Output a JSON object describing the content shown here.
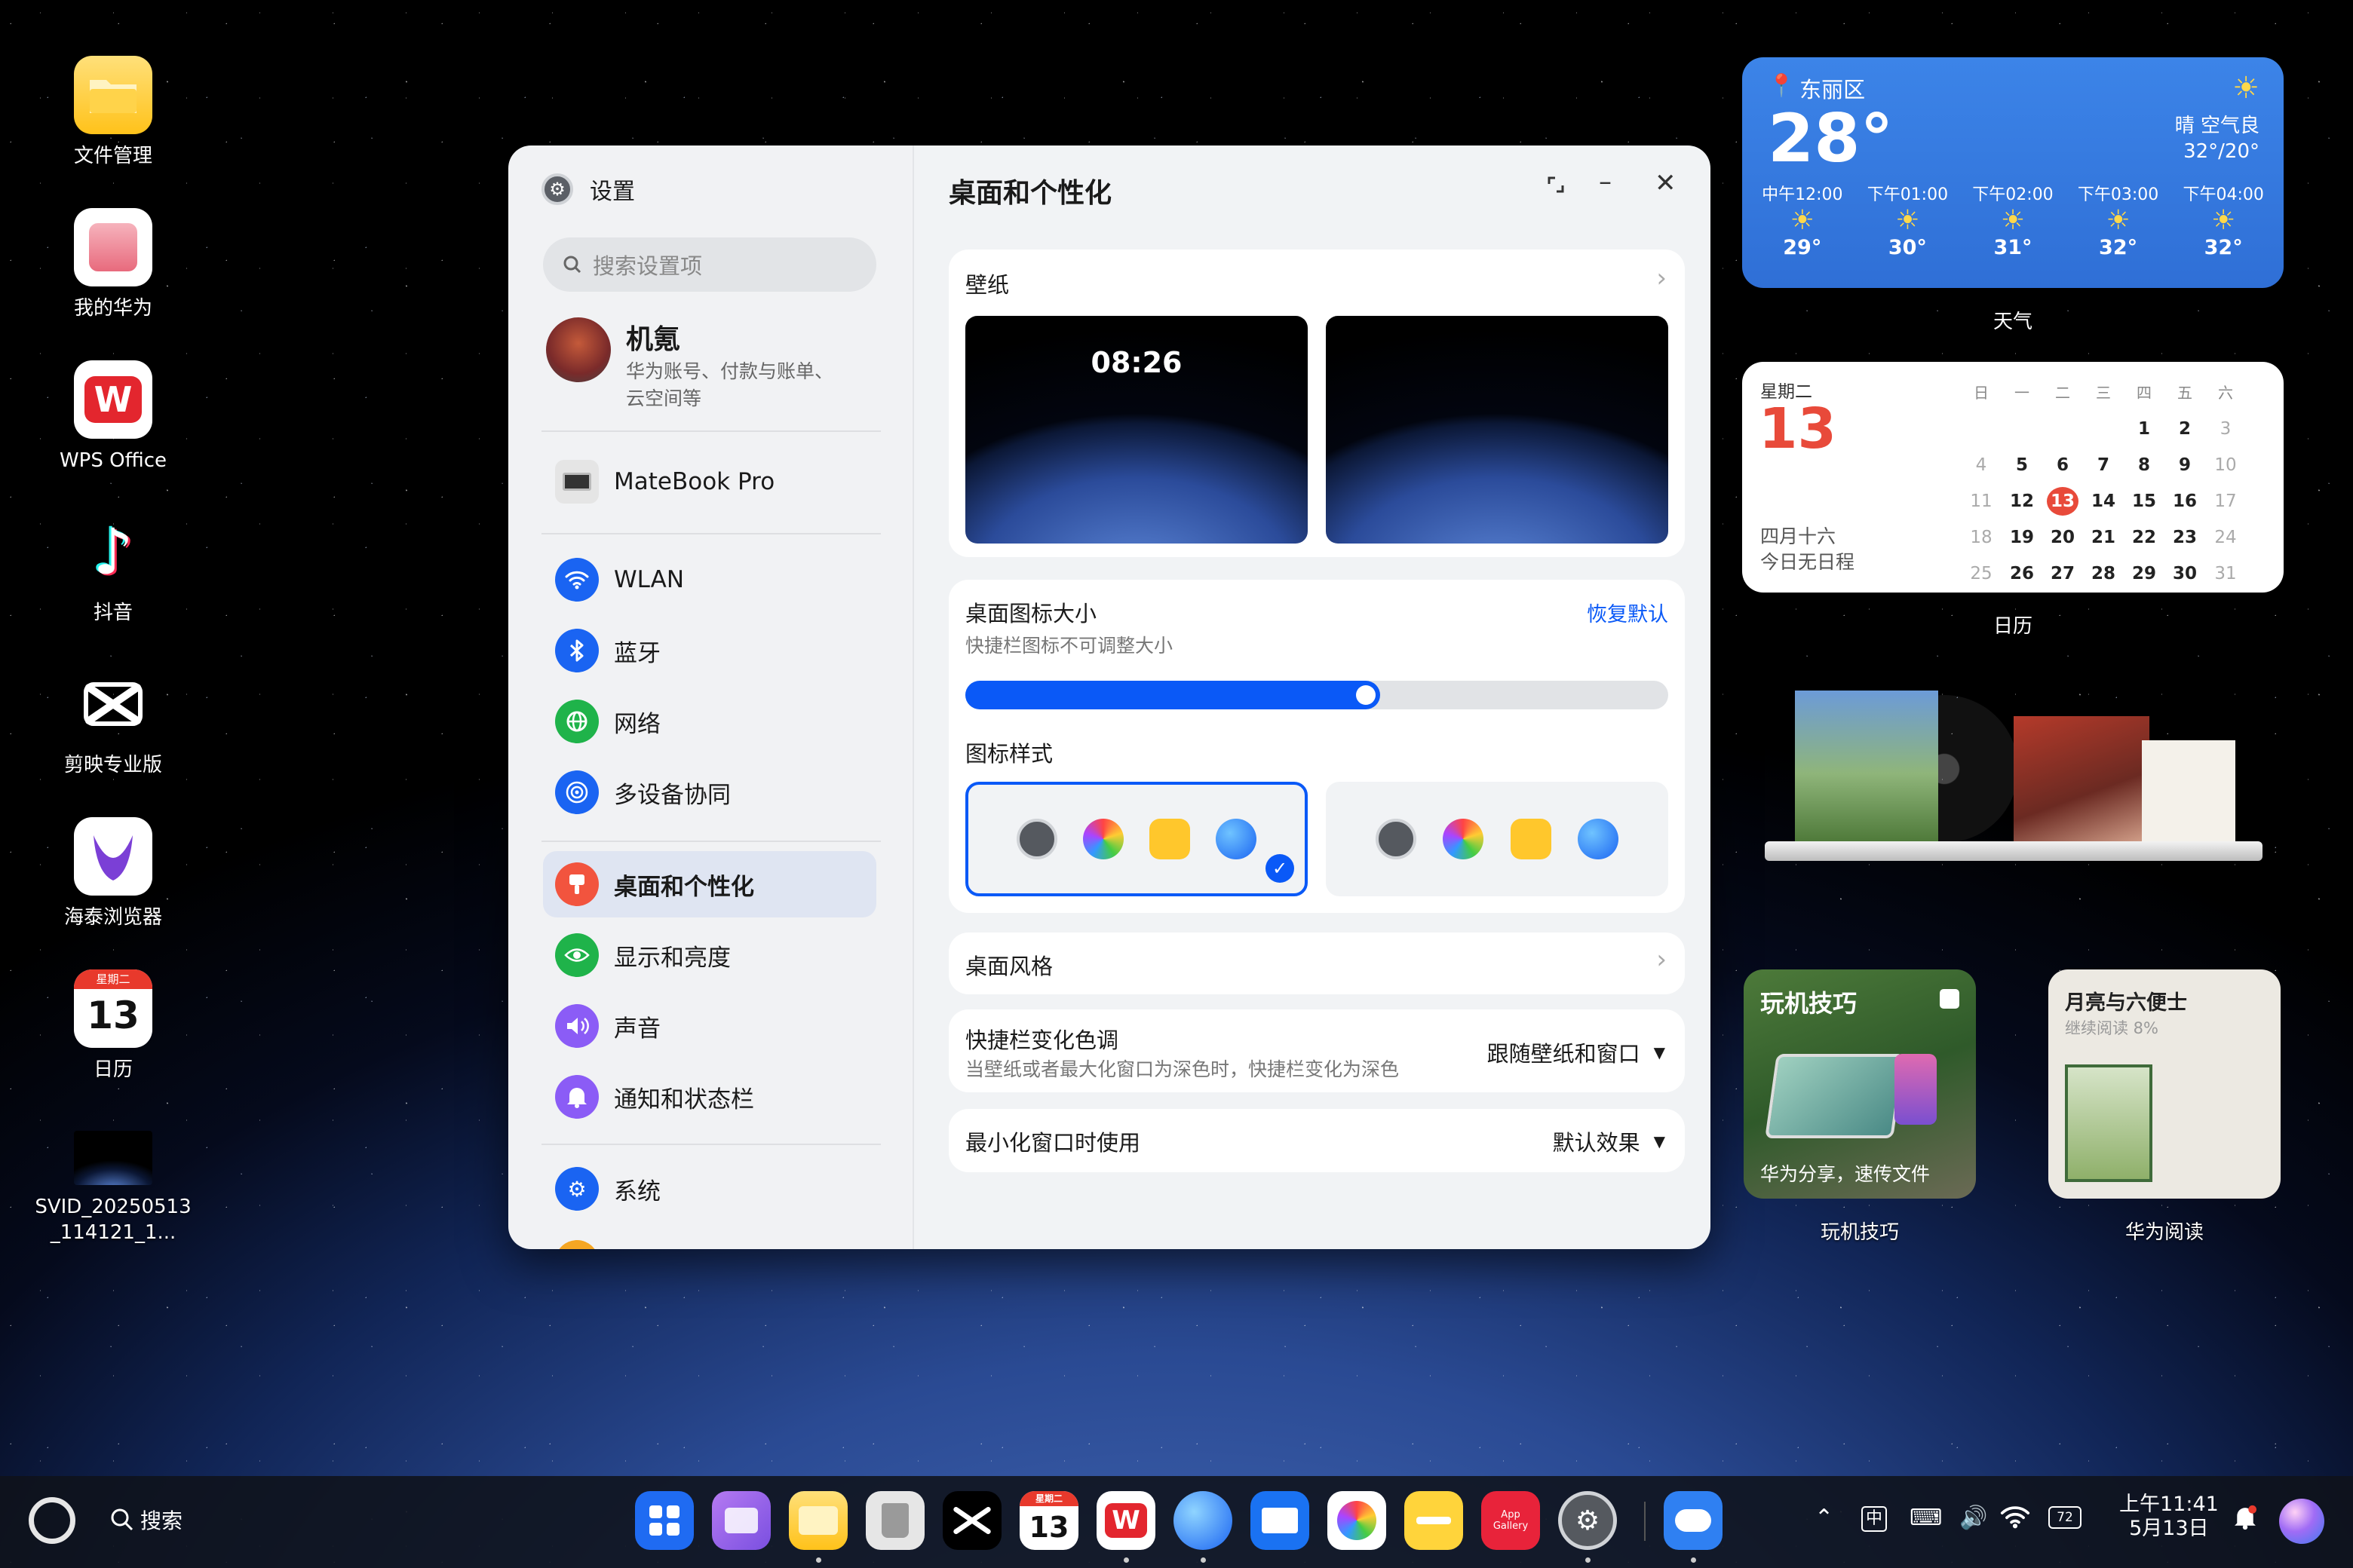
{
  "desktop_icons": [
    {
      "label": "文件管理",
      "icon": "folder-icon",
      "color": "#ffc72c"
    },
    {
      "label": "我的华为",
      "icon": "my-huawei-icon",
      "color": "#f3d0d5"
    },
    {
      "label": "WPS Office",
      "icon": "wps-icon",
      "color": "#ffffff"
    },
    {
      "label": "抖音",
      "icon": "douyin-icon",
      "color": "#000000"
    },
    {
      "label": "剪映专业版",
      "icon": "capcut-icon",
      "color": "#000000"
    },
    {
      "label": "海泰浏览器",
      "icon": "browser-icon",
      "color": "#ffffff"
    },
    {
      "label": "日历",
      "icon": "calendar-icon",
      "color": "#ffffff",
      "badge": "星期二",
      "day": "13"
    },
    {
      "label": "SVID_20250513_114121_1...",
      "icon": "video-thumbnail-icon",
      "color": "#0b1a3a"
    }
  ],
  "window": {
    "app_title": "设置",
    "search_placeholder": "搜索设置项",
    "account": {
      "name": "机氪",
      "sub_line1": "华为账号、付款与账单、",
      "sub_line2": "云空间等"
    },
    "device": "MateBook Pro",
    "items": [
      {
        "label": "WLAN",
        "icon": "wifi-icon",
        "color": "#1a64f2"
      },
      {
        "label": "蓝牙",
        "icon": "bluetooth-icon",
        "color": "#1a64f2"
      },
      {
        "label": "网络",
        "icon": "globe-icon",
        "color": "#1fb34a"
      },
      {
        "label": "多设备协同",
        "icon": "multi-device-icon",
        "color": "#1a64f2"
      },
      {
        "label": "桌面和个性化",
        "icon": "paint-icon",
        "color": "#f2543e"
      },
      {
        "label": "显示和亮度",
        "icon": "eye-icon",
        "color": "#1fb34a"
      },
      {
        "label": "声音",
        "icon": "speaker-icon",
        "color": "#8b5cf6"
      },
      {
        "label": "通知和状态栏",
        "icon": "bell-icon",
        "color": "#8b5cf6"
      },
      {
        "label": "系统",
        "icon": "system-gear-icon",
        "color": "#1a64f2"
      }
    ],
    "main_title": "桌面和个性化",
    "wallpaper": {
      "title": "壁纸",
      "lock_time": "08:26"
    },
    "icon_size": {
      "title": "桌面图标大小",
      "subtitle": "快捷栏图标不可调整大小",
      "reset": "恢复默认",
      "value_percent": 59
    },
    "icon_style_title": "图标样式",
    "desktop_style": "桌面风格",
    "dock_color": {
      "title": "快捷栏变化色调",
      "subtitle": "当壁纸或者最大化窗口为深色时，快捷栏变化为深色",
      "value": "跟随壁纸和窗口"
    },
    "minimize": {
      "title": "最小化窗口时使用",
      "value": "默认效果"
    }
  },
  "weather": {
    "location": "东丽区",
    "temp": "28°",
    "condition": "晴  空气良",
    "range": "32°/20°",
    "hours": [
      {
        "t": "中午12:00",
        "v": "29°"
      },
      {
        "t": "下午01:00",
        "v": "30°"
      },
      {
        "t": "下午02:00",
        "v": "31°"
      },
      {
        "t": "下午03:00",
        "v": "32°"
      },
      {
        "t": "下午04:00",
        "v": "32°"
      }
    ],
    "label": "天气"
  },
  "calendar": {
    "weekday": "星期二",
    "day": "13",
    "lunar": "四月十六",
    "note": "今日无日程",
    "label": "日历",
    "headers": [
      "日",
      "一",
      "二",
      "三",
      "四",
      "五",
      "六"
    ],
    "rows": [
      [
        "",
        "",
        "",
        "",
        "1",
        "2",
        "3"
      ],
      [
        "4",
        "5",
        "6",
        "7",
        "8",
        "9",
        "10"
      ],
      [
        "11",
        "12",
        "13",
        "14",
        "15",
        "16",
        "17"
      ],
      [
        "18",
        "19",
        "20",
        "21",
        "22",
        "23",
        "24"
      ],
      [
        "25",
        "26",
        "27",
        "28",
        "29",
        "30",
        "31"
      ]
    ]
  },
  "tips": {
    "title": "玩机技巧",
    "caption": "华为分享，速传文件",
    "label": "玩机技巧"
  },
  "reading": {
    "title": "月亮与六便士",
    "progress": "继续阅读  8%",
    "label": "华为阅读"
  },
  "taskbar": {
    "search": "搜索",
    "time": "上午11:41",
    "date": "5月13日",
    "battery": "72",
    "ime": "中",
    "cal_badge": "星期二",
    "cal_day": "13",
    "gallery_line1": "App",
    "gallery_line2": "Gallery"
  }
}
